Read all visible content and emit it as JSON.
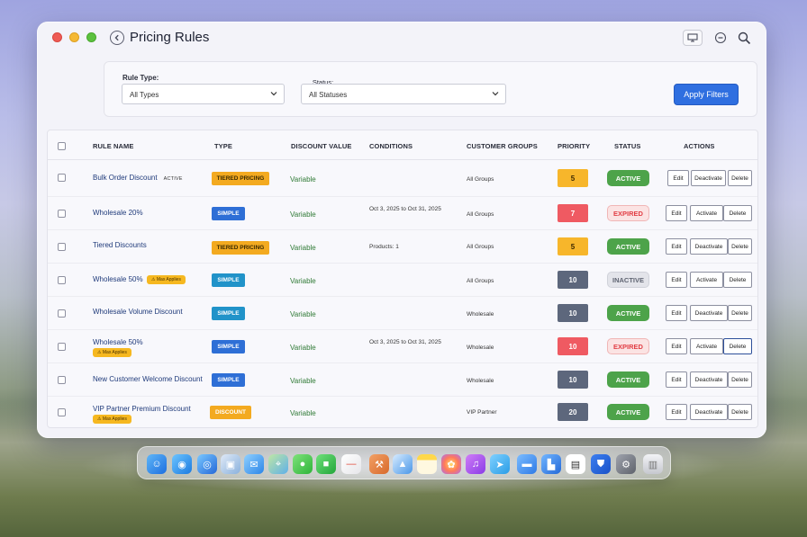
{
  "window": {
    "title": "Pricing Rules"
  },
  "filters": {
    "rule_type_label": "Rule Type:",
    "rule_type_value": "All Types",
    "status_label": "Status:",
    "status_value": "All Statuses",
    "apply_label": "Apply Filters"
  },
  "table": {
    "headers": [
      "RULE NAME",
      "TYPE",
      "DISCOUNT VALUE",
      "CONDITIONS",
      "CUSTOMER GROUPS",
      "PRIORITY",
      "STATUS",
      "ACTIONS"
    ],
    "rows": [
      {
        "name": "Bulk Order Discount",
        "tag": "ACTIVE",
        "badge": "",
        "type": "TIERED PRICING",
        "discount": "Variable",
        "conditions": "",
        "groups": "All Groups",
        "priority": "5",
        "status": "ACTIVE",
        "toggle": "Deactivate",
        "edit": "Edit",
        "delete": "Delete"
      },
      {
        "name": "Wholesale 20%",
        "tag": "",
        "badge": "",
        "type": "SIMPLE",
        "discount": "Variable",
        "conditions": "Oct 3, 2025 to Oct 31, 2025",
        "groups": "All Groups",
        "priority": "7",
        "status": "EXPIRED",
        "toggle": "Activate",
        "edit": "Edit",
        "delete": "Delete"
      },
      {
        "name": "Tiered Discounts",
        "tag": "",
        "badge": "",
        "type": "TIERED PRICING",
        "discount": "Variable",
        "conditions": "Products: 1",
        "groups": "All Groups",
        "priority": "5",
        "status": "ACTIVE",
        "toggle": "Deactivate",
        "edit": "Edit",
        "delete": "Delete"
      },
      {
        "name": "Wholesale 50%",
        "tag": "",
        "badge": "⚠ Max Applies",
        "type": "SIMPLE",
        "discount": "Variable",
        "conditions": "",
        "groups": "All Groups",
        "priority": "10",
        "status": "INACTIVE",
        "toggle": "Activate",
        "edit": "Edit",
        "delete": "Delete"
      },
      {
        "name": "Wholesale Volume Discount",
        "tag": "",
        "badge": "",
        "type": "SIMPLE",
        "discount": "Variable",
        "conditions": "",
        "groups": "Wholesale",
        "priority": "10",
        "status": "ACTIVE",
        "toggle": "Deactivate",
        "edit": "Edit",
        "delete": "Delete"
      },
      {
        "name": "Wholesale 50%",
        "tag": "",
        "badge": "⚠ Max Applies",
        "type": "SIMPLE",
        "discount": "Variable",
        "conditions": "Oct 3, 2025 to Oct 31, 2025",
        "groups": "Wholesale",
        "priority": "10",
        "status": "EXPIRED",
        "toggle": "Activate",
        "edit": "Edit",
        "delete": "Delete"
      },
      {
        "name": "New Customer Welcome Discount",
        "tag": "",
        "badge": "",
        "type": "SIMPLE",
        "discount": "Variable",
        "conditions": "",
        "groups": "Wholesale",
        "priority": "10",
        "status": "ACTIVE",
        "toggle": "Deactivate",
        "edit": "Edit",
        "delete": "Delete"
      },
      {
        "name": "VIP Partner Premium Discount",
        "tag": "",
        "badge": "⚠ Max Applies",
        "type": "DISCOUNT",
        "discount": "Variable",
        "conditions": "",
        "groups": "VIP Partner",
        "priority": "20",
        "status": "ACTIVE",
        "toggle": "Deactivate",
        "edit": "Edit",
        "delete": "Delete"
      }
    ]
  },
  "colors": {
    "accent": "#2f6fe0",
    "active": "#4da34a",
    "expired": "#e23d44",
    "warning": "#f3aa20"
  },
  "dock": {
    "icons": [
      "finder-icon",
      "safari-icon",
      "safari-alt-icon",
      "preview-icon",
      "mail-icon",
      "maps-icon",
      "messages-icon",
      "facetime-icon",
      "reminders-icon",
      "instruments-icon",
      "xcode-icon",
      "notes-icon",
      "photos-icon",
      "music-icon",
      "telegram-icon",
      "folder-icon",
      "app-store-icon",
      "document-icon",
      "bitwarden-icon",
      "settings-icon",
      "trash-icon"
    ]
  }
}
